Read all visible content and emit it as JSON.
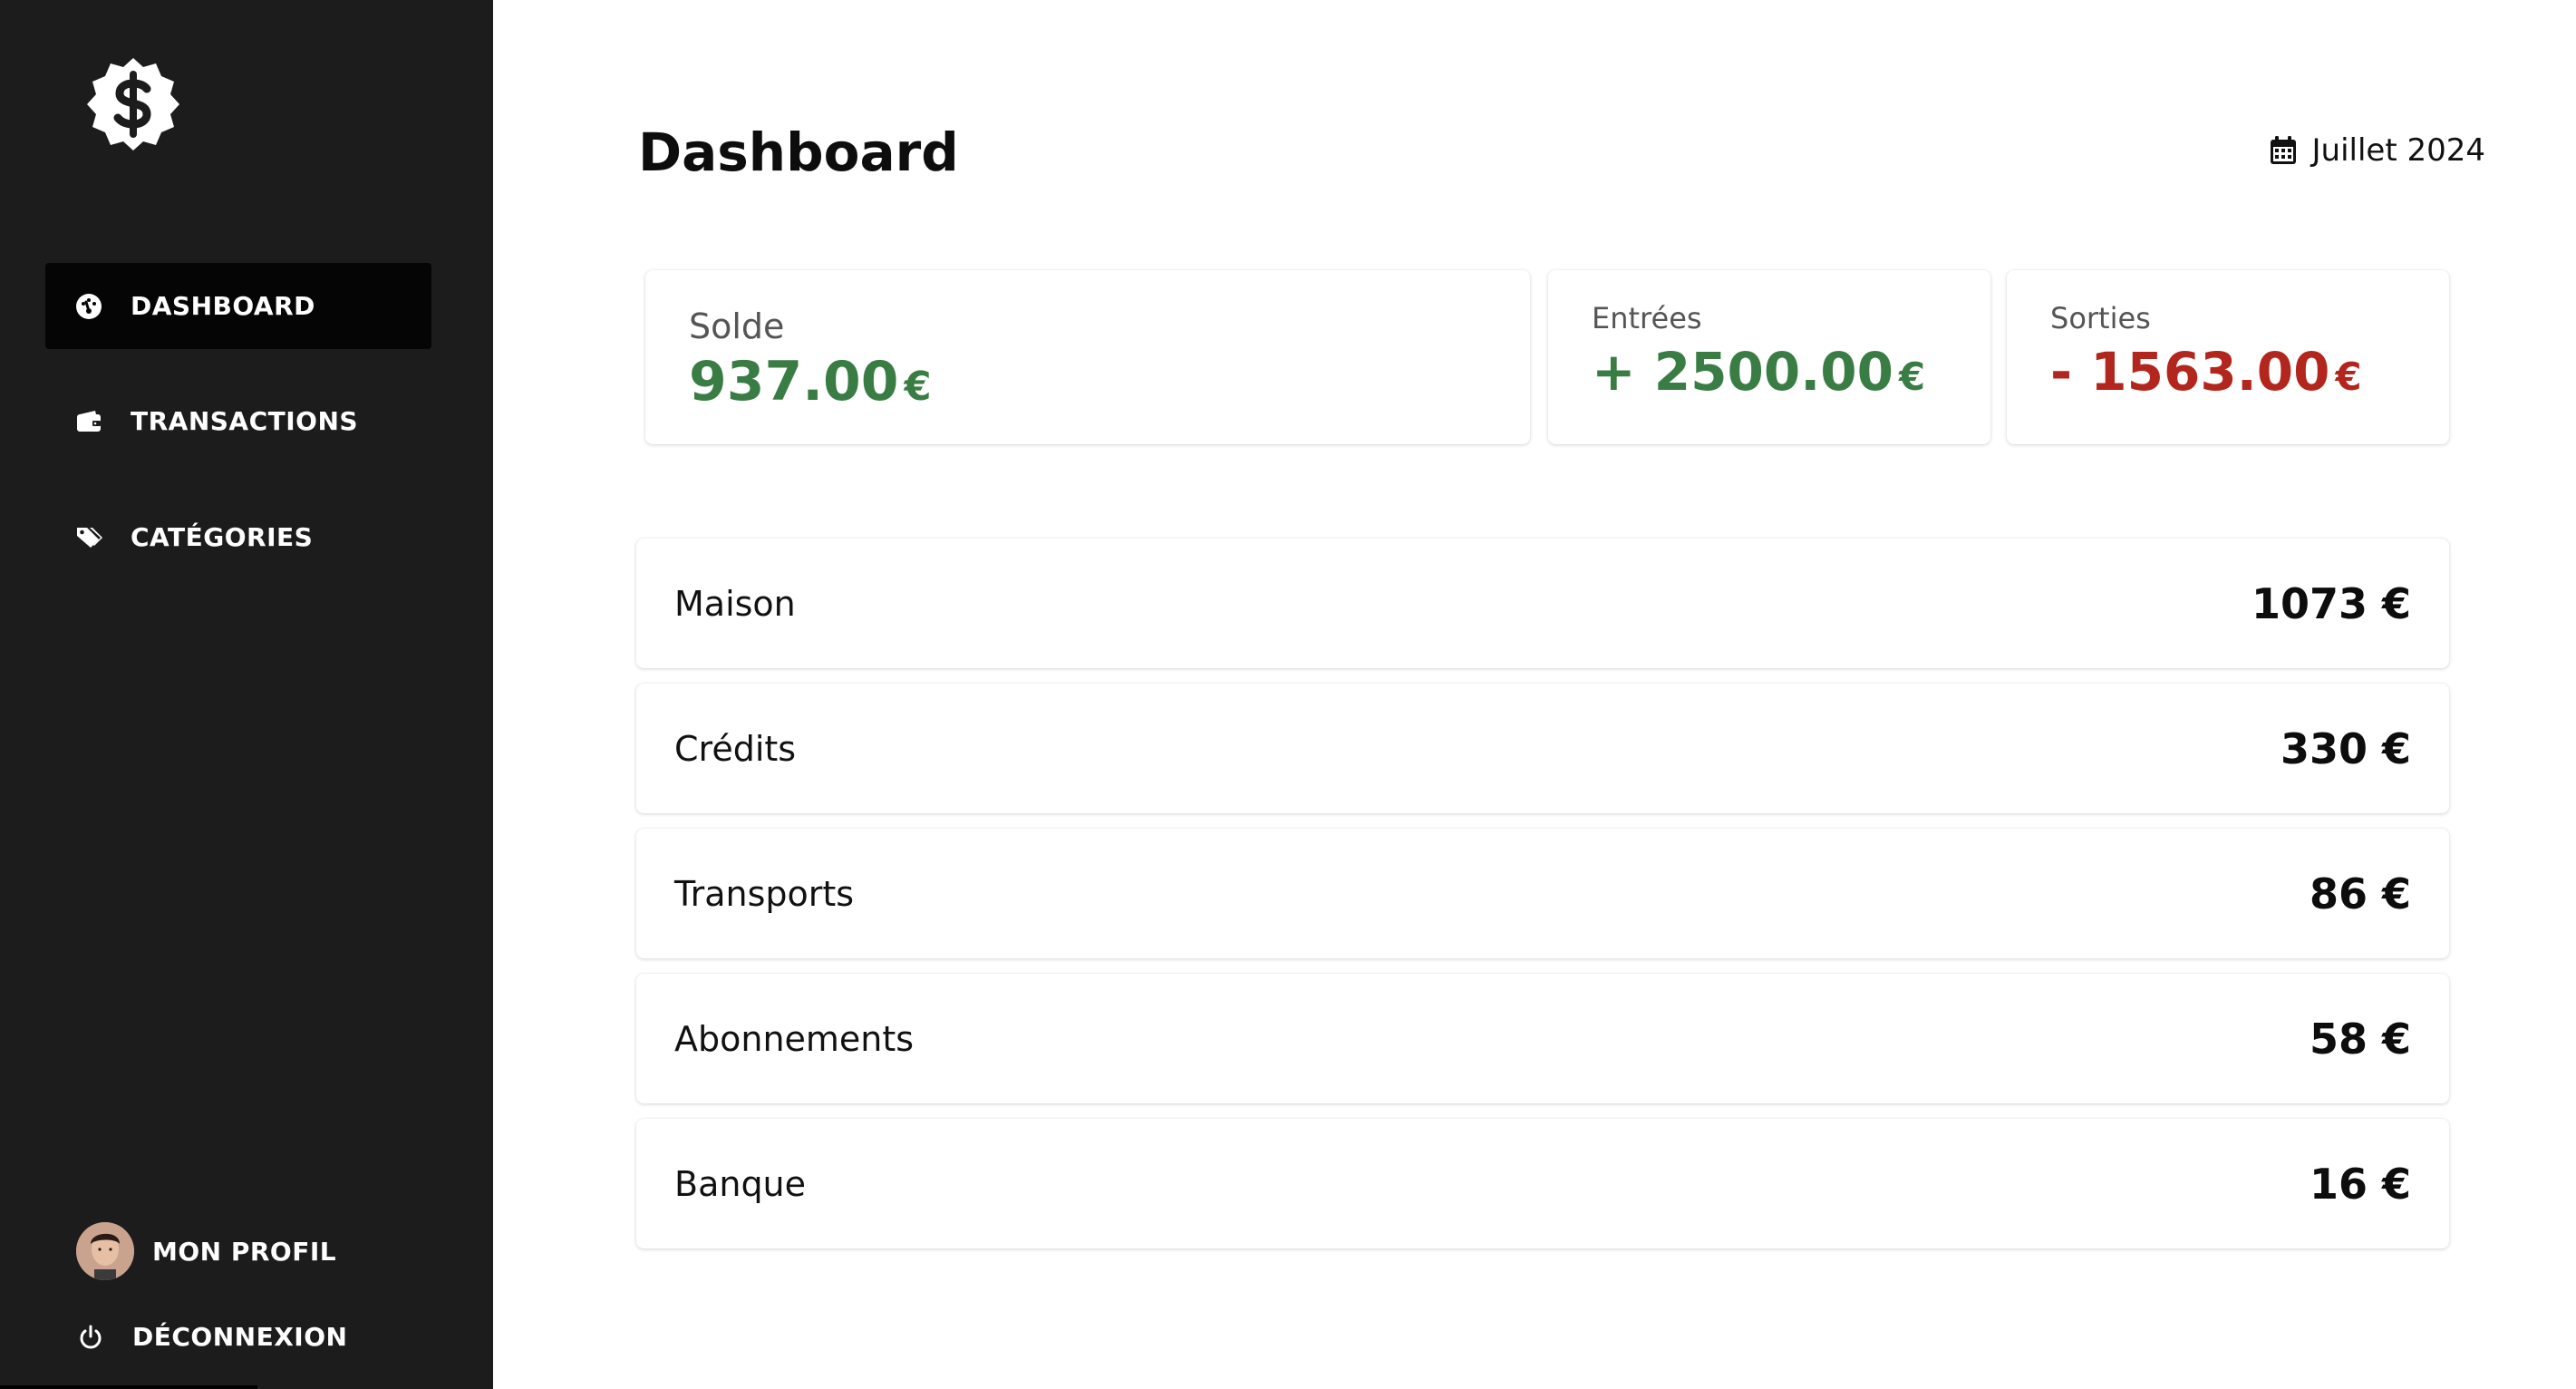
{
  "sidebar": {
    "logo_icon": "dollar-badge-icon",
    "items": [
      {
        "label": "DASHBOARD",
        "icon": "gauge-icon",
        "active": true
      },
      {
        "label": "TRANSACTIONS",
        "icon": "wallet-icon",
        "active": false
      },
      {
        "label": "CATÉGORIES",
        "icon": "tags-icon",
        "active": false
      }
    ],
    "profile": {
      "label": "MON PROFIL",
      "icon": "avatar"
    },
    "logout": {
      "label": "DÉCONNEXION",
      "icon": "power-icon"
    }
  },
  "header": {
    "title": "Dashboard",
    "month": "Juillet 2024",
    "month_icon": "calendar-icon"
  },
  "summary": {
    "balance": {
      "label": "Solde",
      "value": "937.00",
      "currency": "€"
    },
    "income": {
      "label": "Entrées",
      "value": "+ 2500.00",
      "currency": "€"
    },
    "expenses": {
      "label": "Sorties",
      "value": "- 1563.00",
      "currency": "€"
    }
  },
  "categories": [
    {
      "name": "Maison",
      "amount": "1073 €"
    },
    {
      "name": "Crédits",
      "amount": "330 €"
    },
    {
      "name": "Transports",
      "amount": "86 €"
    },
    {
      "name": "Abonnements",
      "amount": "58 €"
    },
    {
      "name": "Banque",
      "amount": "16 €"
    }
  ],
  "colors": {
    "sidebar_bg": "#1c1c1c",
    "active_item_bg": "#050505",
    "positive": "#3a7d44",
    "negative": "#b3261e"
  }
}
